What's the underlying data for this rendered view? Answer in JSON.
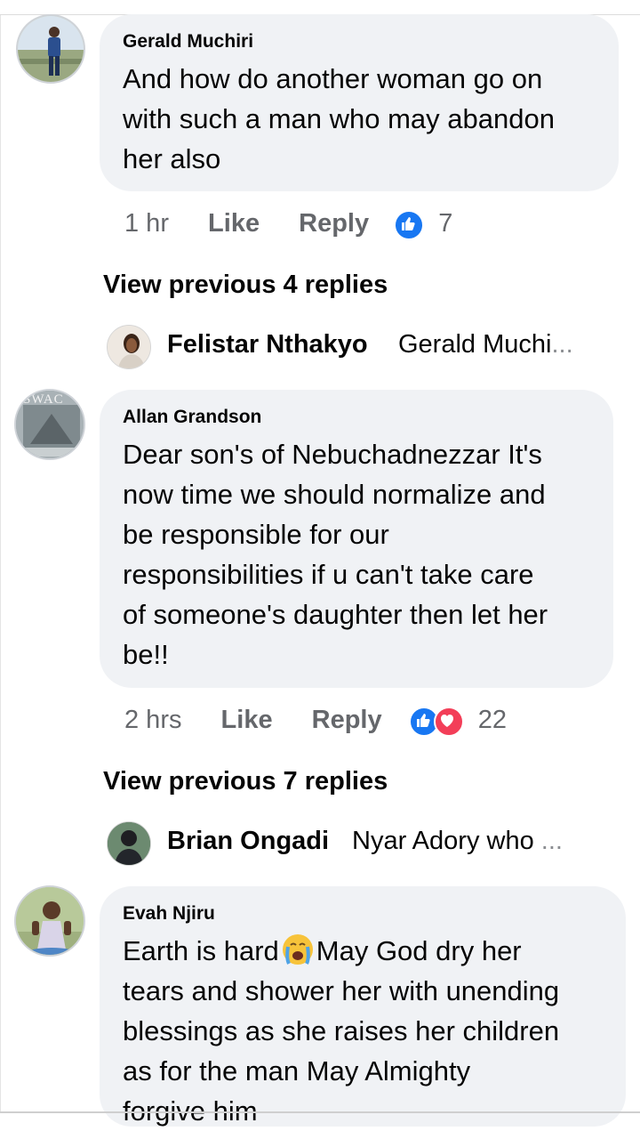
{
  "comments": [
    {
      "author": "Gerald Muchiri",
      "text": "And how do another woman go on\nwith such a man who may abandon\nher also",
      "time": "1 hr",
      "like_label": "Like",
      "reply_label": "Reply",
      "reaction_count": "7",
      "reactions": [
        "like-icon"
      ]
    },
    {
      "author": "Allan Grandson",
      "avatar_text": "SWAC",
      "text": "Dear son's of Nebuchadnezzar It's\nnow time we should normalize and\nbe responsible for our\nresponsibilities if u can't take care\nof someone's daughter then let her\nbe!!",
      "time": "2 hrs",
      "like_label": "Like",
      "reply_label": "Reply",
      "reaction_count": "22",
      "reactions": [
        "like-icon",
        "love-icon"
      ]
    },
    {
      "author": "Evah Njiru",
      "text_part1": "Earth is hard",
      "text_part2": "May God dry her",
      "text_rest": "tears and shower her with unending\nblessings as she raises her children\nas for the man May Almighty\nforgive him",
      "emoji": "crying-face-icon"
    }
  ],
  "view_previous": [
    "View previous 4 replies",
    "View previous 7 replies"
  ],
  "reply_previews": [
    {
      "author": "Felistar Nthakyo",
      "text": "Gerald Muchi",
      "ellipsis": "..."
    },
    {
      "author": "Brian Ongadi",
      "text": "Nyar Adory who ",
      "ellipsis": "..."
    }
  ],
  "colors": {
    "bubble": "#f0f2f5",
    "meta": "#65676b",
    "like_blue": "#1877f2",
    "love_red": "#f33e58"
  }
}
